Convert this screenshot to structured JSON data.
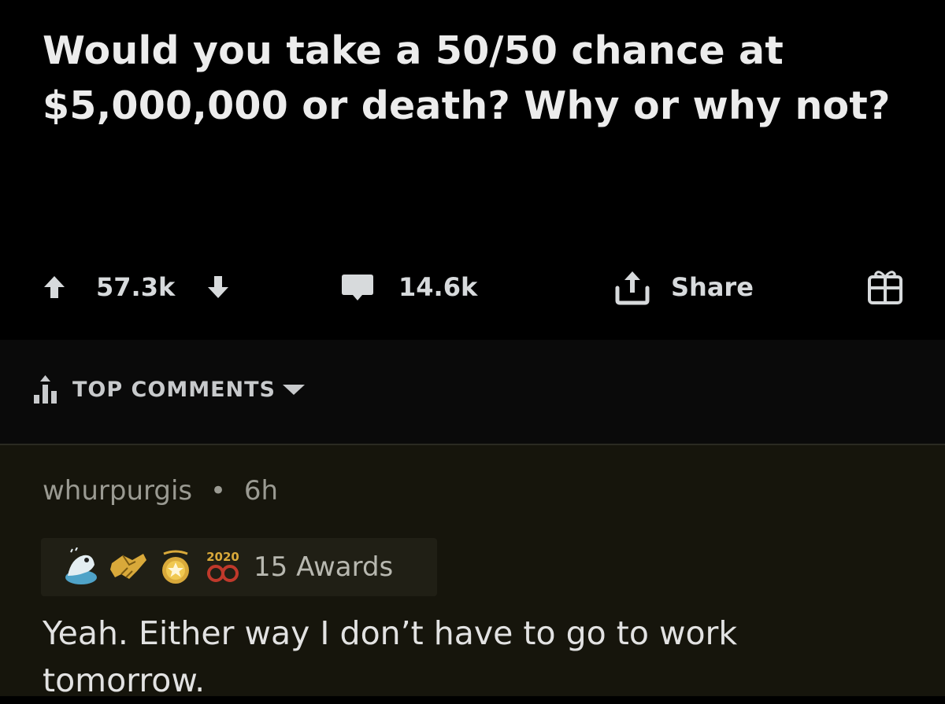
{
  "post": {
    "title": "Would you take a 50/50 chance at $5,000,000 or death? Why or why not?",
    "upvotes": "57.3k",
    "comments": "14.6k",
    "share_label": "Share"
  },
  "sort": {
    "label": "TOP COMMENTS"
  },
  "comment": {
    "author": "whurpurgis",
    "separator": "•",
    "age": "6h",
    "awards_label": "15 Awards",
    "award_badge_text": "2020",
    "body": "Yeah. Either way I don’t have to go to work tomorrow."
  },
  "icons": {
    "upvote": "upvote-arrow-icon",
    "downvote": "downvote-arrow-icon",
    "comment": "comment-bubble-icon",
    "share": "share-icon",
    "award": "gift-award-icon",
    "sort": "bar-chart-icon",
    "sort_dropdown": "caret-down-icon"
  },
  "colors": {
    "background": "#000000",
    "comment_background": "#16150c",
    "text": "#d7dadc",
    "award_gold": "#d9a93a"
  }
}
